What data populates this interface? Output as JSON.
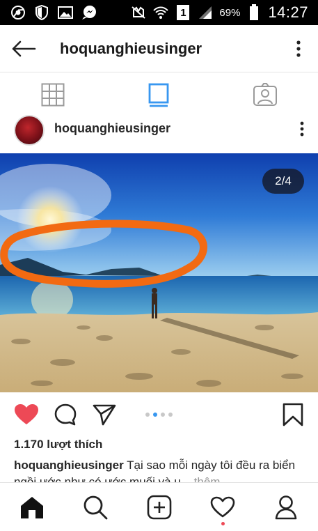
{
  "status_bar": {
    "battery": "69%",
    "time": "14:27",
    "sim_badge": "1",
    "icons": [
      "chrome-icon",
      "shield-icon",
      "gallery-icon",
      "messenger-icon",
      "mute-icon",
      "wifi-icon",
      "signal-icon",
      "battery-icon"
    ]
  },
  "header": {
    "title": "hoquanghieusinger",
    "back_icon": "arrow-left-icon",
    "more_icon": "more-vertical-icon"
  },
  "tabs": [
    {
      "icon": "grid-icon",
      "active": false
    },
    {
      "icon": "feed-icon",
      "active": true
    },
    {
      "icon": "tagged-icon",
      "active": false
    }
  ],
  "post": {
    "username": "hoquanghieusinger",
    "carousel_counter": "2/4",
    "likes": "1.170 lượt thích",
    "caption_user": "hoquanghieusinger",
    "caption_text": "Tại sao mỗi ngày tôi đều ra biển ngồi ước như có ước muối và u...",
    "caption_more": "thêm",
    "carousel_dots": 4,
    "carousel_active_index": 1
  },
  "colors": {
    "accent": "#3897f0",
    "like_red": "#ed4956",
    "text": "#262626"
  },
  "bottom_nav": [
    "home-icon",
    "search-icon",
    "add-icon",
    "activity-icon",
    "profile-icon"
  ]
}
